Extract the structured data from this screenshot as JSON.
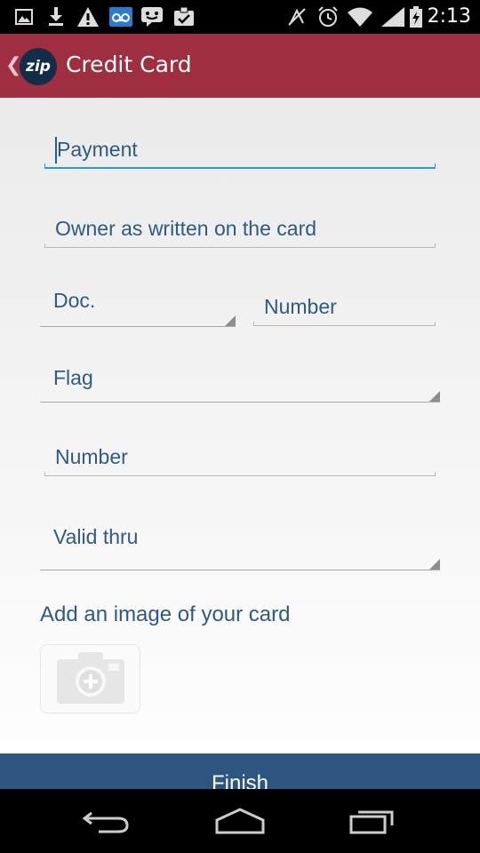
{
  "status_bar": {
    "time": "2:13",
    "left_icons": [
      "image-icon",
      "download-icon",
      "warning-icon",
      "voicemail-icon",
      "chat-icon",
      "clipboard-icon"
    ],
    "right_icons": [
      "signal-off-icon",
      "alarm-icon",
      "wifi-icon",
      "cell-signal-icon",
      "battery-icon"
    ]
  },
  "header": {
    "back_icon": "chevron-left-icon",
    "logo_text": "zip",
    "title": "Credit Card",
    "color": "#9f2e40"
  },
  "form": {
    "payment": {
      "text": "Payment",
      "focused": true
    },
    "owner": {
      "text": "Owner as written on the card"
    },
    "doc_type": {
      "text": "Doc."
    },
    "doc_number": {
      "text": "Number"
    },
    "flag": {
      "text": "Flag"
    },
    "card_number": {
      "text": "Number"
    },
    "valid_thru": {
      "text": "Valid thru"
    }
  },
  "image_section": {
    "label": "Add an image of your card",
    "button_icon": "camera-add-icon"
  },
  "footer": {
    "finish_label": "Finish",
    "color": "#2c5580"
  },
  "nav_bar": {
    "buttons": [
      "back-icon",
      "home-icon",
      "recents-icon"
    ]
  },
  "colors": {
    "text_accent": "#2e5a84",
    "focus_line": "#2a9dc9"
  }
}
